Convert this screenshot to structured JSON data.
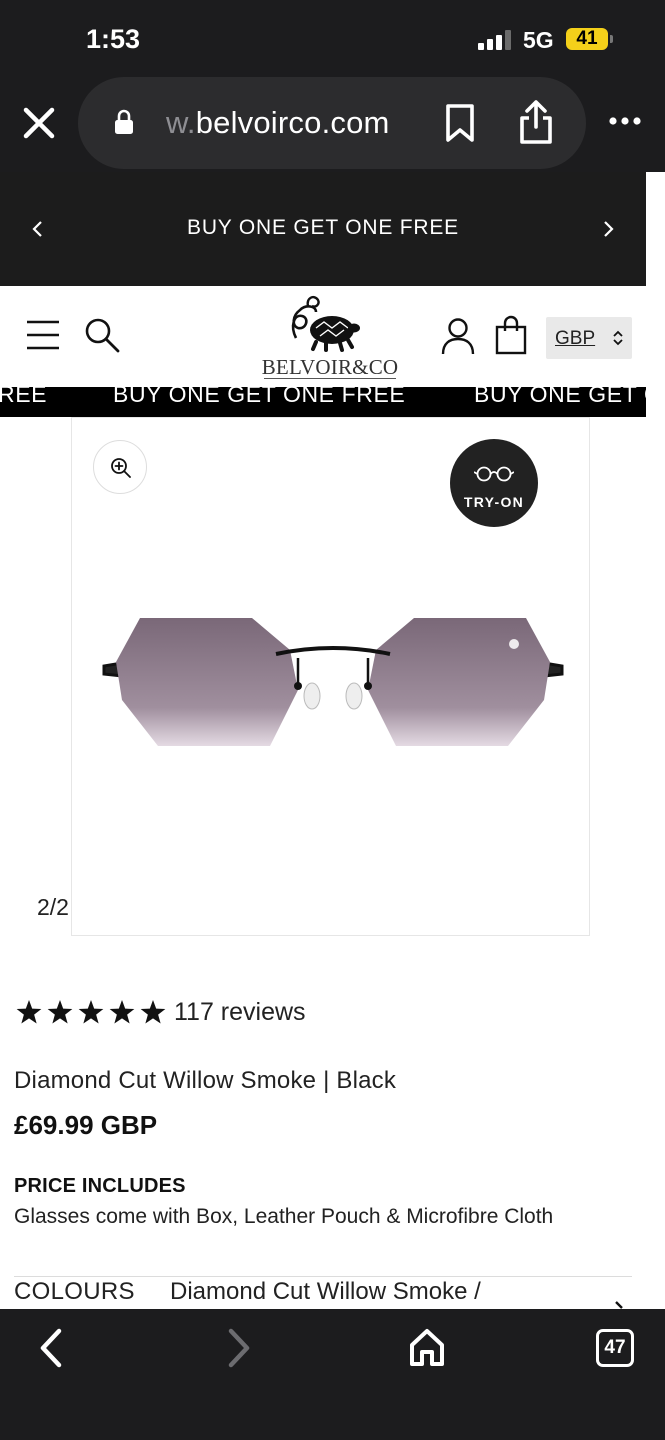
{
  "status_bar": {
    "time": "1:53",
    "network": "5G",
    "battery": "41"
  },
  "browser": {
    "url_prefix": "w.",
    "url_main": "belvoirco.com"
  },
  "promo": {
    "text": "BUY ONE GET ONE FREE"
  },
  "header": {
    "logo_text": "BELVOIR&CO",
    "currency": "GBP"
  },
  "marquee": {
    "items": [
      "REE",
      "BUY ONE GET ONE FREE",
      "BUY ONE GET O"
    ]
  },
  "gallery": {
    "try_on_label": "TRY-ON",
    "counter": "2/2"
  },
  "product": {
    "rating_stars": 5,
    "reviews": "117 reviews",
    "title": "Diamond Cut Willow Smoke | Black",
    "price": "£69.99 GBP",
    "includes_heading": "PRICE INCLUDES",
    "includes_text": "Glasses come with Box, Leather Pouch & Microfibre Cloth",
    "colours_label": "COLOURS",
    "colours_value": "Diamond Cut Willow Smoke /"
  },
  "toolbar": {
    "tab_count": "47"
  },
  "colors": {
    "chrome_bg": "#1c1c1e",
    "promo_bg": "#1c1c1c",
    "battery": "#f4d01a",
    "lens": "#8a7484"
  }
}
